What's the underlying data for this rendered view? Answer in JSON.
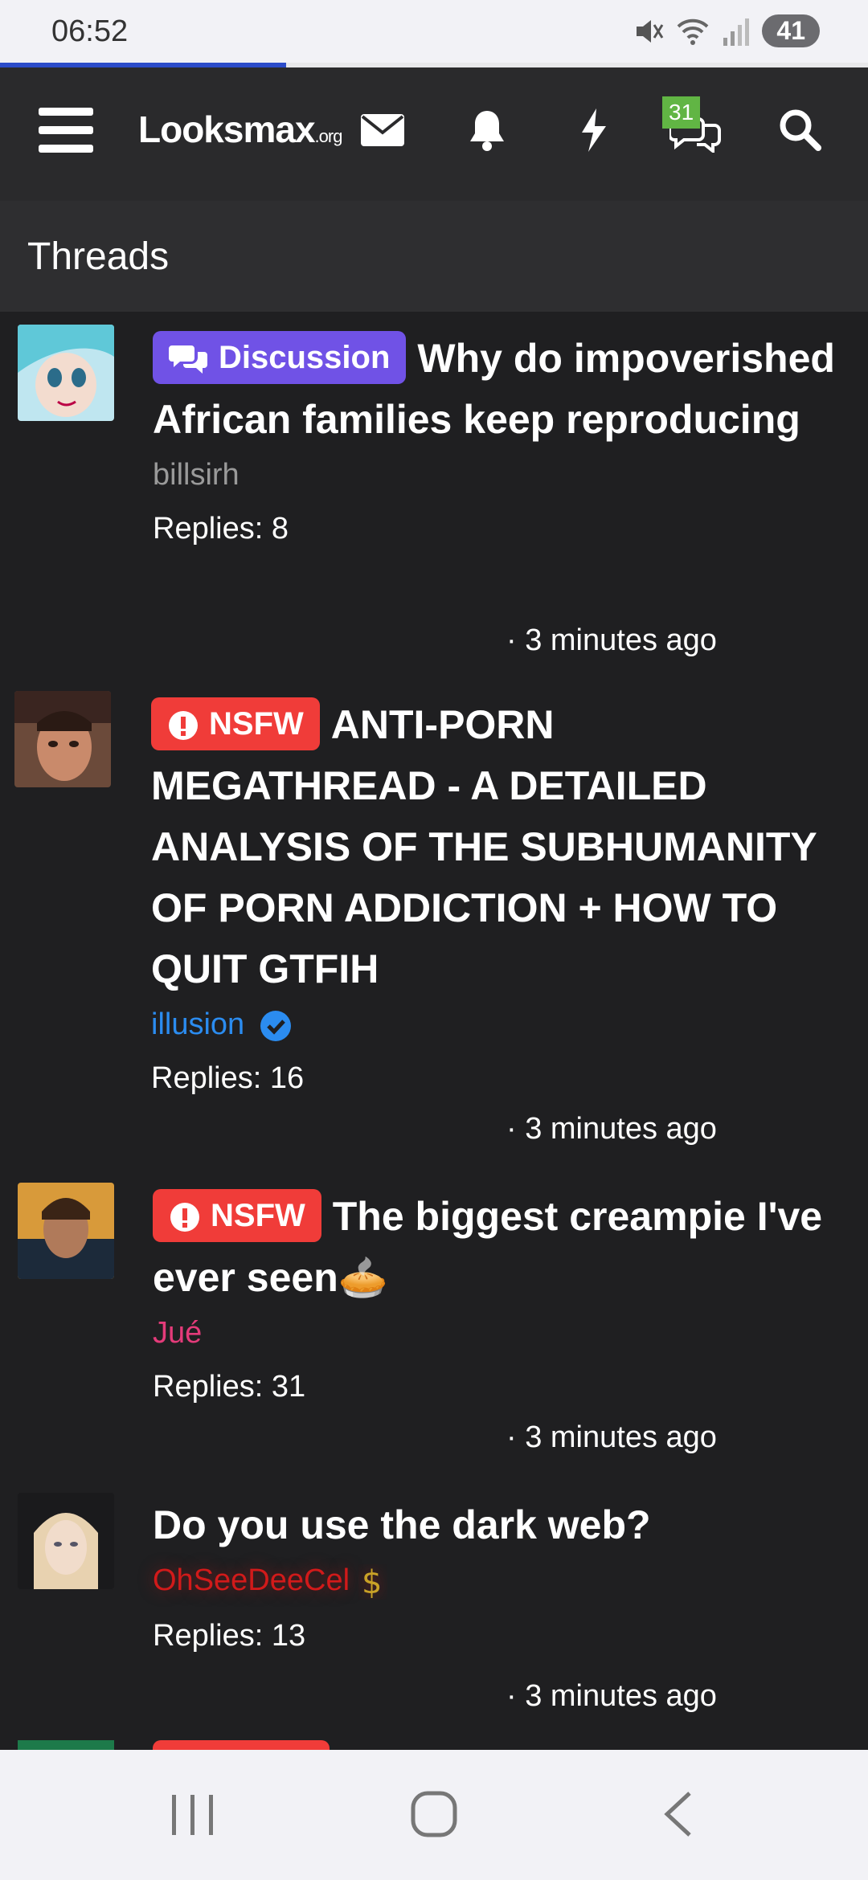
{
  "status_bar": {
    "time": "06:52",
    "battery": "41"
  },
  "page_progress": 0.33,
  "header": {
    "logo_main": "Looksmax",
    "logo_suffix": ".org",
    "chat_badge": "31",
    "icons": [
      "menu-icon",
      "envelope-icon",
      "bell-icon",
      "lightning-icon",
      "chat-icon",
      "search-icon"
    ]
  },
  "page_title": "Threads",
  "threads": [
    {
      "prefix": "Discussion",
      "title": "Why do impoverished African families keep reproducing",
      "author": "billsirh",
      "author_color": "#9a9a9a",
      "replies": "Replies: 8",
      "ago": "· 3 minutes ago"
    },
    {
      "prefix": "NSFW",
      "title": "ANTI-PORN MEGATHREAD - A DETAILED ANALYSIS OF THE SUBHUMANITY OF PORN ADDICTION + HOW TO QUIT GTFIH",
      "author": "illusion",
      "author_color": "#2b8cf0",
      "replies": "Replies: 16",
      "ago": "· 3 minutes ago"
    },
    {
      "prefix": "NSFW",
      "title": "The biggest creampie I've ever seen🥧",
      "author": "Jué",
      "author_color": "#e43b7a",
      "replies": "Replies: 31",
      "ago": "· 3 minutes ago"
    },
    {
      "prefix": "",
      "title": "Do you use the dark web?",
      "author": "OhSeeDeeCel",
      "author_color": "#d11a1a",
      "replies": "Replies: 13",
      "ago": "· 3 minutes ago"
    }
  ],
  "colors": {
    "discussion": "#7052e6",
    "nsfw": "#f03c39",
    "background": "#1f1f21",
    "header": "#2a2a2c"
  }
}
